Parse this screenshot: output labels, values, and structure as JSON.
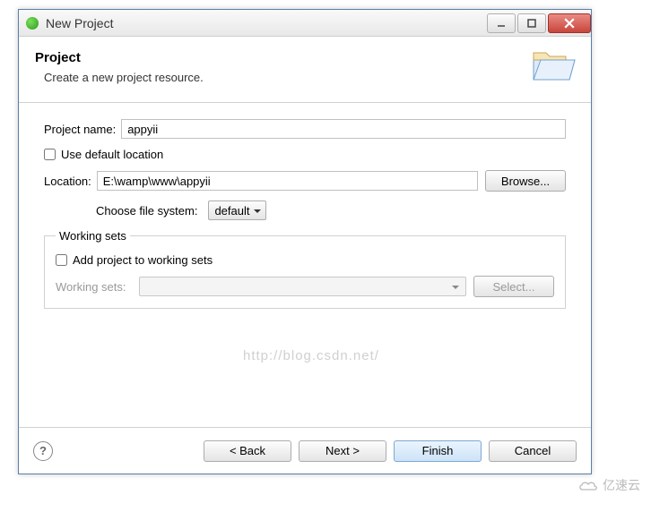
{
  "window": {
    "title": "New Project"
  },
  "header": {
    "title": "Project",
    "subtitle": "Create a new project resource."
  },
  "form": {
    "project_name_label": "Project name:",
    "project_name_value": "appyii",
    "use_default_location_label": "Use default location",
    "use_default_location_checked": false,
    "location_label": "Location:",
    "location_value": "E:\\wamp\\www\\appyii",
    "browse_label": "Browse...",
    "choose_fs_label": "Choose file system:",
    "choose_fs_value": "default"
  },
  "working_sets": {
    "legend": "Working sets",
    "add_label": "Add project to working sets",
    "add_checked": false,
    "select_label": "Working sets:",
    "select_button": "Select..."
  },
  "footer": {
    "back": "< Back",
    "next": "Next >",
    "finish": "Finish",
    "cancel": "Cancel"
  },
  "watermark": "http://blog.csdn.net/",
  "brand": "亿速云"
}
